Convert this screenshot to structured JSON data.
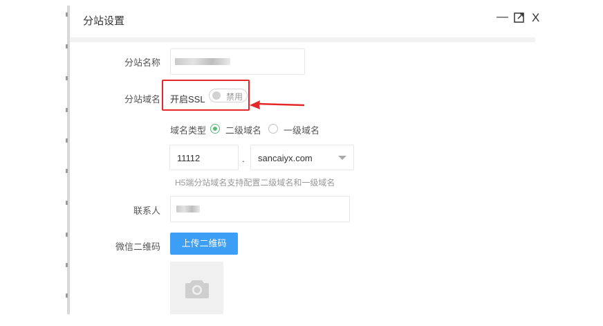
{
  "dialog": {
    "title": "分站设置",
    "controls": {
      "minimize": "—",
      "maximize": "⛶",
      "close": "X"
    }
  },
  "form": {
    "site_name_label": "分站名称",
    "site_domain_label": "分站域名",
    "ssl": {
      "label": "开启SSL",
      "switch_text": "禁用",
      "enabled": false
    },
    "domain_type": {
      "label": "域名类型",
      "options": [
        "二级域名",
        "一级域名"
      ],
      "selected": "二级域名"
    },
    "subdomain_value": "11112",
    "dot": ".",
    "root_domain_value": "sancaiyx.com",
    "domain_hint": "H5端分站域名支持配置二级域名和一级域名",
    "contact_label": "联系人",
    "wechat_qr_label": "微信二维码",
    "upload_button": "上传二维码"
  },
  "colors": {
    "annotation": "#e52727",
    "primary_button": "#3d9ef5",
    "radio_checked": "#5fb878"
  },
  "icons": {
    "qr_placeholder": "camera-icon"
  }
}
